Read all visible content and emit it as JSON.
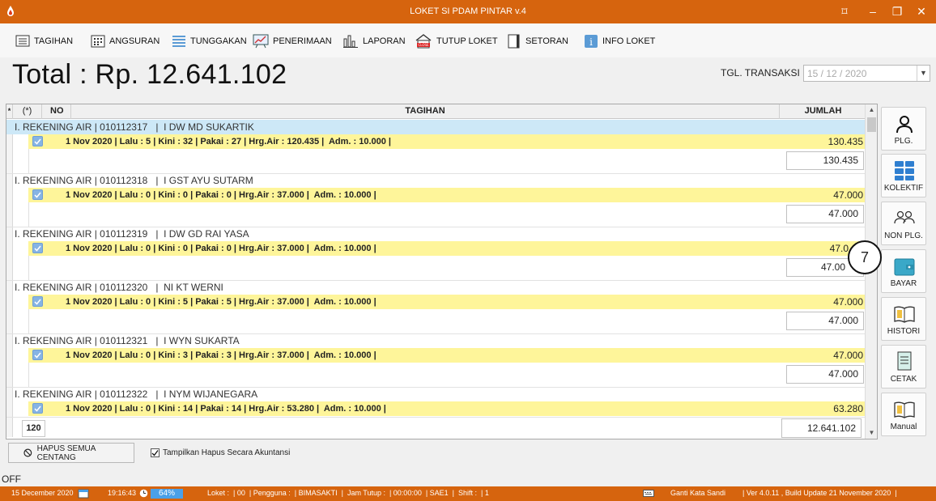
{
  "window": {
    "title": "LOKET SI PDAM PINTAR v.4",
    "controls": [
      "⌑",
      "–",
      "❐",
      "✕"
    ]
  },
  "toolbar": {
    "items": [
      {
        "label": "TAGIHAN",
        "icon": "monitor-list-icon"
      },
      {
        "label": "ANGSURAN",
        "icon": "calendar-grid-icon"
      },
      {
        "label": "TUNGGAKAN",
        "icon": "list-lines-icon"
      },
      {
        "label": "PENERIMAAN",
        "icon": "chart-board-icon"
      },
      {
        "label": "LAPORAN",
        "icon": "bar-chart-icon"
      },
      {
        "label": "TUTUP LOKET",
        "icon": "close-shop-icon"
      },
      {
        "label": "SETORAN",
        "icon": "document-icon"
      },
      {
        "label": "INFO LOKET",
        "icon": "info-icon"
      }
    ]
  },
  "total": {
    "text": "Total :  Rp. 12.641.102"
  },
  "tgl": {
    "label": "TGL. TRANSAKSI",
    "value": "15 / 12 / 2020"
  },
  "grid": {
    "headers": {
      "star": "*",
      "check": "(*)",
      "no": "NO",
      "tagihan": "TAGIHAN",
      "jumlah": "JUMLAH"
    },
    "groups": [
      {
        "label": "I. REKENING AIR | 010112317   |  I DW MD SUKARTIK",
        "detail": "1 Nov 2020 | Lalu : 5 | Kini : 32 | Pakai : 27 | Hrg.Air : 120.435 |  Adm. : 10.000 |",
        "amount": "130.435",
        "subtotal": "130.435"
      },
      {
        "label": "I. REKENING AIR | 010112318   |  I GST AYU SUTARM",
        "detail": "1 Nov 2020 | Lalu : 0 | Kini : 0 | Pakai : 0 | Hrg.Air : 37.000 |  Adm. : 10.000 |",
        "amount": "47.000",
        "subtotal": "47.000"
      },
      {
        "label": "I. REKENING AIR | 010112319   |  I DW GD RAI YASA",
        "detail": "1 Nov 2020 | Lalu : 0 | Kini : 0 | Pakai : 0 | Hrg.Air : 37.000 |  Adm. : 10.000 |",
        "amount": "47.0",
        "subtotal": "47.00"
      },
      {
        "label": "I. REKENING AIR | 010112320   |  NI KT WERNI",
        "detail": "1 Nov 2020 | Lalu : 0 | Kini : 5 | Pakai : 5 | Hrg.Air : 37.000 |  Adm. : 10.000 |",
        "amount": "47.000",
        "subtotal": "47.000"
      },
      {
        "label": "I. REKENING AIR | 010112321   |  I WYN SUKARTA",
        "detail": "1 Nov 2020 | Lalu : 0 | Kini : 3 | Pakai : 3 | Hrg.Air : 37.000 |  Adm. : 10.000 |",
        "amount": "47.000",
        "subtotal": "47.000"
      },
      {
        "label": "I. REKENING AIR | 010112322   |  I NYM WIJANEGARA",
        "detail": "1 Nov 2020 | Lalu : 0 | Kini : 14 | Pakai : 14 | Hrg.Air : 53.280 |  Adm. : 10.000 |",
        "amount": "63.280",
        "subtotal": ""
      }
    ],
    "footer": {
      "count": "120",
      "total": "12.641.102"
    }
  },
  "side_buttons": [
    {
      "label": "PLG.",
      "icon": "person-icon"
    },
    {
      "label": "KOLEKTIF",
      "icon": "grid-blocks-icon"
    },
    {
      "label": "NON PLG.",
      "icon": "people-icon"
    },
    {
      "label": "BAYAR",
      "icon": "wallet-icon"
    },
    {
      "label": "HISTORI",
      "icon": "book-icon"
    },
    {
      "label": "CETAK",
      "icon": "print-document-icon"
    },
    {
      "label": "Manual",
      "icon": "manual-book-icon"
    }
  ],
  "annotation": {
    "number": "7"
  },
  "bottom": {
    "hapus_label": "HAPUS SEMUA CENTANG",
    "checkbox_label": "Tampilkan Hapus Secara Akuntansi",
    "checkbox_checked": true,
    "off_text": "OFF"
  },
  "status": {
    "date": "15 December 2020",
    "time": "19:16:43",
    "progress": "64%",
    "loket": "Loket :  | 00  | Pengguna :  | BIMASAKTI  |  Jam Tutup :  | 00:00:00  | SAE1  |  Shift :  | 1",
    "ganti": "Ganti Kata Sandi",
    "version": "| Ver 4.0.11 , Build Update 21 November 2020  |"
  },
  "colors": {
    "accent": "#d6640e",
    "detail_row": "#fef59a",
    "selected_row": "#cde8f7",
    "check": "#86b4e4"
  }
}
